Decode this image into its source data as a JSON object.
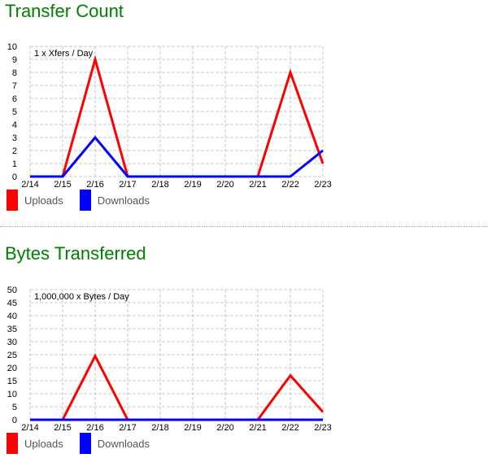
{
  "chart_data": [
    {
      "type": "line",
      "title": "Transfer Count",
      "annotation": "1 x Xfers / Day",
      "xlabel": "",
      "ylabel": "",
      "categories": [
        "2/14",
        "2/15",
        "2/16",
        "2/17",
        "2/18",
        "2/19",
        "2/20",
        "2/21",
        "2/22",
        "2/23"
      ],
      "yticks": [
        0,
        1,
        2,
        3,
        4,
        5,
        6,
        7,
        8,
        9,
        10
      ],
      "ylim": [
        0,
        10
      ],
      "grid": true,
      "legend_position": "bottom-left",
      "series": [
        {
          "name": "Uploads",
          "color": "#ff0000",
          "values": [
            0,
            0,
            9,
            0,
            0,
            0,
            0,
            0,
            8,
            1
          ]
        },
        {
          "name": "Downloads",
          "color": "#0000ff",
          "values": [
            0,
            0,
            3,
            0,
            0,
            0,
            0,
            0,
            0,
            2
          ]
        }
      ]
    },
    {
      "type": "line",
      "title": "Bytes Transferred",
      "annotation": "1,000,000 x Bytes / Day",
      "xlabel": "",
      "ylabel": "",
      "categories": [
        "2/14",
        "2/15",
        "2/16",
        "2/17",
        "2/18",
        "2/19",
        "2/20",
        "2/21",
        "2/22",
        "2/23"
      ],
      "yticks": [
        0,
        5,
        10,
        15,
        20,
        25,
        30,
        35,
        40,
        45,
        50
      ],
      "ylim": [
        0,
        50
      ],
      "grid": true,
      "legend_position": "bottom-left",
      "series": [
        {
          "name": "Uploads",
          "color": "#ff0000",
          "values": [
            0,
            0,
            24.5,
            0,
            0,
            0,
            0,
            0,
            17,
            3
          ]
        },
        {
          "name": "Downloads",
          "color": "#0000ff",
          "values": [
            0,
            0,
            0,
            0,
            0,
            0,
            0,
            0,
            0,
            0
          ]
        }
      ]
    }
  ],
  "sections": [
    {
      "title": "Transfer Count"
    },
    {
      "title": "Bytes Transferred"
    }
  ]
}
